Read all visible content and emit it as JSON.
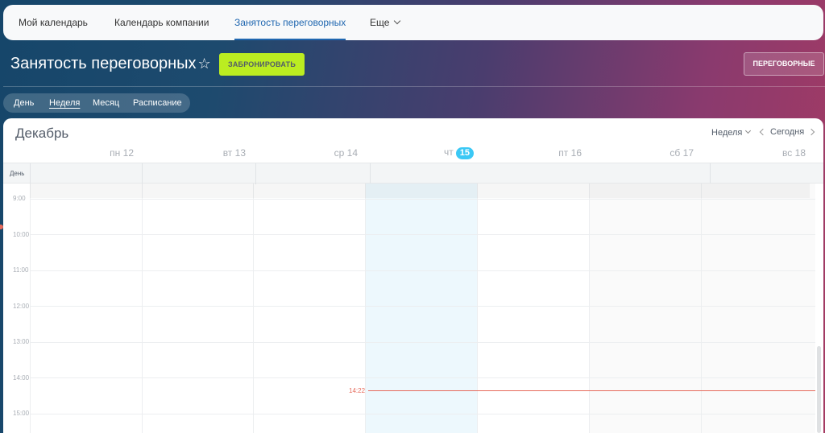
{
  "nav": {
    "tabs": [
      {
        "label": "Мой календарь"
      },
      {
        "label": "Календарь компании"
      },
      {
        "label": "Занятость переговорных"
      },
      {
        "label": "Еще"
      }
    ]
  },
  "header": {
    "title": "Занятость переговорных",
    "book_label": "ЗАБРОНИРОВАТЬ",
    "rooms_label": "ПЕРЕГОВОРНЫЕ",
    "accent_color": "#bbed21"
  },
  "views": [
    {
      "label": "День"
    },
    {
      "label": "Неделя"
    },
    {
      "label": "Месяц"
    },
    {
      "label": "Расписание"
    }
  ],
  "calendar": {
    "month": "Декабрь",
    "view_select": "Неделя",
    "today_label": "Сегодня",
    "days": [
      {
        "name": "пн",
        "num": "12"
      },
      {
        "name": "вт",
        "num": "13"
      },
      {
        "name": "ср",
        "num": "14"
      },
      {
        "name": "чт",
        "num": "15"
      },
      {
        "name": "пт",
        "num": "16"
      },
      {
        "name": "сб",
        "num": "17"
      },
      {
        "name": "вс",
        "num": "18"
      }
    ],
    "allday_label": "День",
    "hours": [
      "9:00",
      "10:00",
      "11:00",
      "12:00",
      "13:00",
      "14:00",
      "15:00"
    ],
    "now_time": "14:22",
    "today_color": "#3bc8f5",
    "now_color": "#e66a5b"
  }
}
